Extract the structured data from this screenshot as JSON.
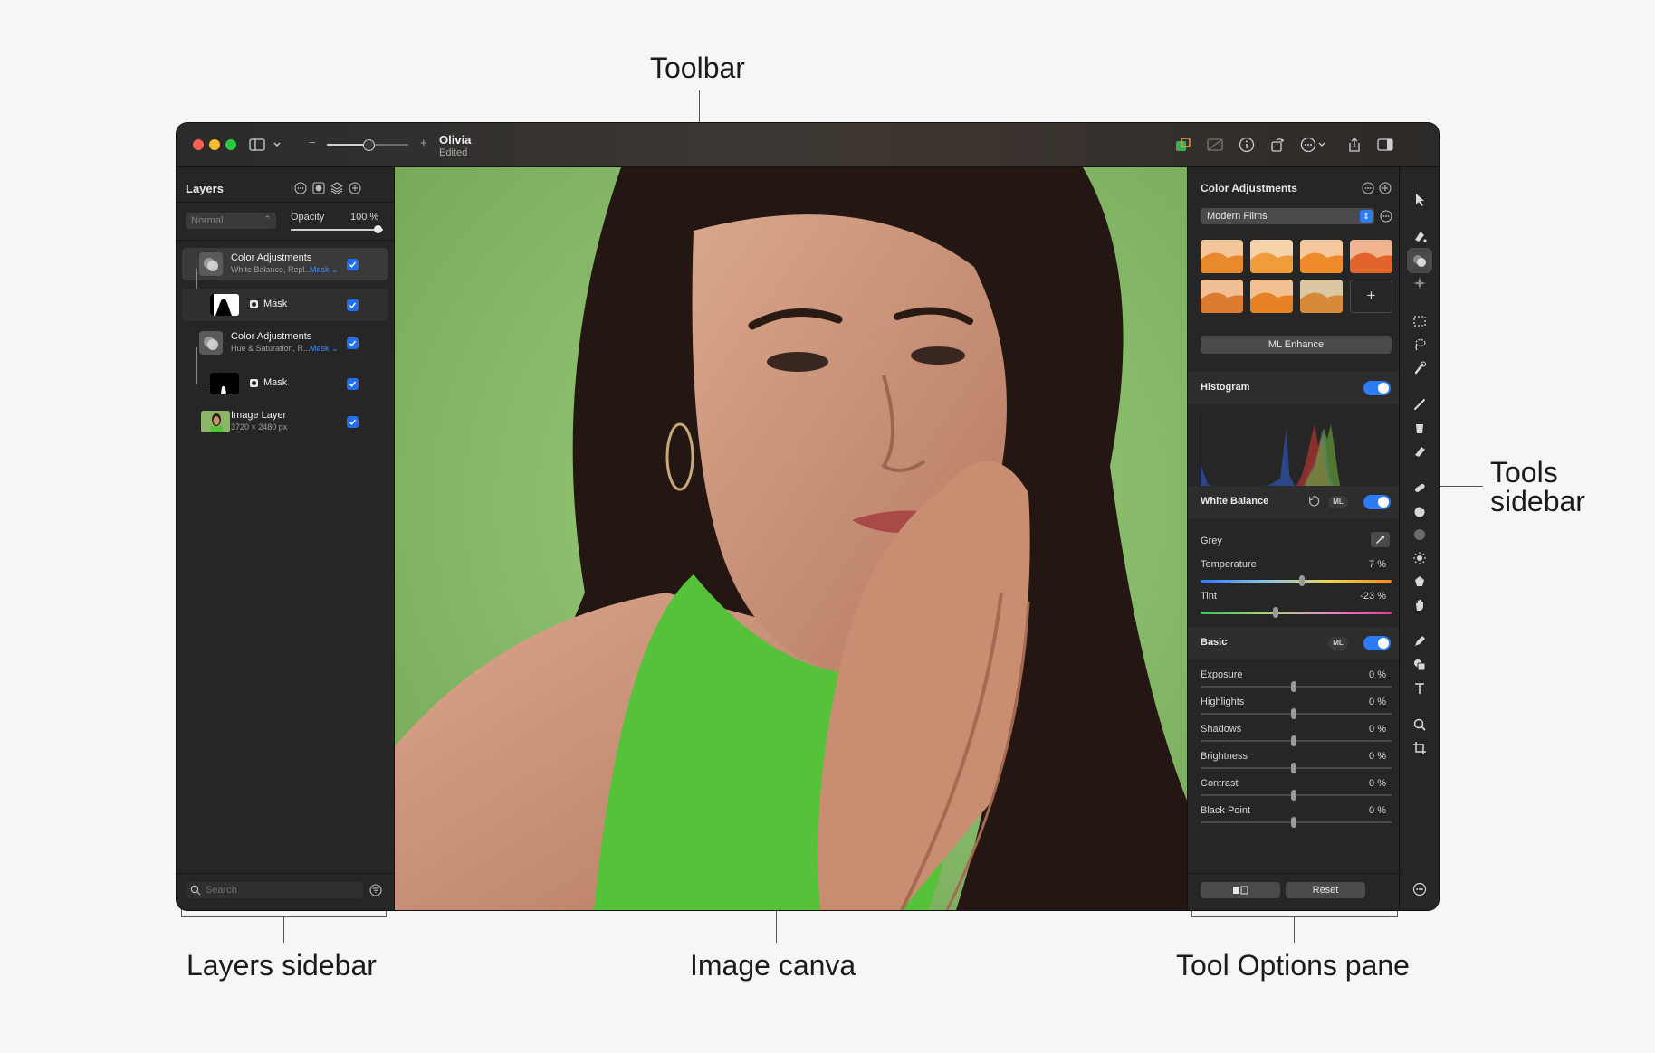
{
  "callouts": {
    "toolbar": "Toolbar",
    "tools_sidebar": "Tools\nsidebar",
    "layers_sidebar": "Layers sidebar",
    "image_canvas": "Image canva",
    "tool_options": "Tool Options pane"
  },
  "toolbar": {
    "zoom_minus": "−",
    "zoom_plus": "+",
    "doc_title": "Olivia",
    "doc_subtitle": "Edited"
  },
  "layers": {
    "title": "Layers",
    "blend_mode": "Normal",
    "opacity_label": "Opacity",
    "opacity_value": "100 %",
    "items": [
      {
        "name": "Color Adjustments",
        "sub": "White Balance, Repl...",
        "mask_link": "Mask",
        "checked": true
      },
      {
        "name": "Mask",
        "checked": true
      },
      {
        "name": "Color Adjustments",
        "sub": "Hue & Saturation, R...",
        "mask_link": "Mask",
        "checked": true
      },
      {
        "name": "Mask",
        "checked": true
      },
      {
        "name": "Image Layer",
        "sub": "3720 × 2480 px",
        "checked": true
      }
    ],
    "search_placeholder": "Search"
  },
  "options": {
    "title": "Color Adjustments",
    "preset_group": "Modern Films",
    "preset_add": "+",
    "ml_enhance": "ML Enhance",
    "histogram_label": "Histogram",
    "histogram_on": true,
    "white_balance": {
      "label": "White Balance",
      "ml": "ML",
      "on": true,
      "grey_label": "Grey",
      "temperature_label": "Temperature",
      "temperature_value": "7 %",
      "temperature_level": 0.53,
      "tint_label": "Tint",
      "tint_value": "-23 %",
      "tint_level": 0.39
    },
    "basic": {
      "label": "Basic",
      "ml": "ML",
      "on": true,
      "sliders": [
        {
          "label": "Exposure",
          "value": "0 %"
        },
        {
          "label": "Highlights",
          "value": "0 %"
        },
        {
          "label": "Shadows",
          "value": "0 %"
        },
        {
          "label": "Brightness",
          "value": "0 %"
        },
        {
          "label": "Contrast",
          "value": "0 %"
        },
        {
          "label": "Black Point",
          "value": "0 %"
        }
      ]
    },
    "reset": "Reset"
  },
  "tools": [
    "pointer-icon",
    "paint-bucket-icon",
    "color-adjust-icon",
    "sparkle-icon",
    "rect-select-icon",
    "lasso-icon",
    "quick-select-icon",
    "brush-icon",
    "bucket-icon",
    "eraser-icon",
    "repair-icon",
    "clone-icon",
    "blur-icon",
    "light-icon",
    "distort-icon",
    "smudge-icon",
    "pen-icon",
    "shapes-icon",
    "text-icon",
    "zoom-icon",
    "crop-icon",
    "more-icon"
  ],
  "colors": {
    "accent": "#2d7cf6",
    "canvas_bg": "#8fc06f"
  }
}
